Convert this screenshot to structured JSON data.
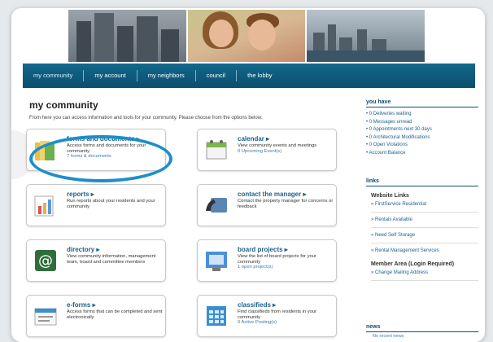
{
  "nav": {
    "items": [
      "my community",
      "my account",
      "my neighbors",
      "council",
      "the lobby"
    ]
  },
  "main": {
    "title": "my community",
    "description": "From here you can access information and tools for your community. Please choose from the options below:",
    "cards": [
      {
        "title": "forms and documents ▸",
        "desc": "Access forms and documents for your community",
        "count": "7 forms & documents"
      },
      {
        "title": "calendar ▸",
        "desc": "View community events and meetings",
        "count": "0 Upcoming Event(s)"
      },
      {
        "title": "reports ▸",
        "desc": "Run reports about your residents and your community",
        "count": ""
      },
      {
        "title": "contact the manager ▸",
        "desc": "Contact the property manager for concerns or feedback",
        "count": ""
      },
      {
        "title": "directory ▸",
        "desc": "View community information, management team, board and committee members",
        "count": ""
      },
      {
        "title": "board projects ▸",
        "desc": "View the list of board projects for your community",
        "count": "1 open project(s)"
      },
      {
        "title": "e-forms ▸",
        "desc": "Access forms that can be completed and sent electronically",
        "count": ""
      },
      {
        "title": "classifieds ▸",
        "desc": "Find classifieds from residents in your community",
        "count": "0 Active Posting(s)"
      }
    ]
  },
  "sidebar": {
    "you_have_title": "you have",
    "you_have": [
      "0 Deliveries waiting",
      "0 Messages unread",
      "0 Appointments next 30 days",
      "0 Architectural Modifications",
      "0 Open Violations",
      "Account Balance"
    ],
    "links_title": "links",
    "website_links_title": "Website Links",
    "website_links": [
      "» FirstService Residential",
      "» Rentals Available",
      "» Need Self Storage",
      "» Rental Management Services"
    ],
    "member_area_title": "Member Area (Login Required)",
    "member_links": [
      "» Change Mailing Address"
    ],
    "news_title": "news",
    "news_empty": "No recent news"
  },
  "colors": {
    "nav_bg": "#0a4e6d",
    "link": "#1e5f8a",
    "highlight": "#1b8fc9"
  }
}
